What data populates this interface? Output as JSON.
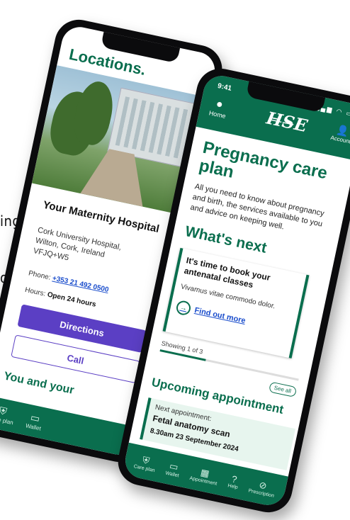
{
  "cut_text": {
    "line1": "ing",
    "line2": "on"
  },
  "back_phone": {
    "title": "Locations.",
    "hospital_name": "Your Maternity Hospital",
    "address": [
      "Cork University Hospital,",
      "Wilton, Cork, Ireland",
      "VFJQ+W5"
    ],
    "phone_label": "Phone:",
    "phone_number": "+353 21 492 0500",
    "hours_label": "Hours:",
    "hours_value": "Open 24 hours",
    "directions": "Directions",
    "call": "Call",
    "section_title": "You and your",
    "nav": [
      {
        "label": "Care plan",
        "icon": "shield-icon"
      },
      {
        "label": "Wallet",
        "icon": "wallet-icon"
      }
    ]
  },
  "front_phone": {
    "status_time": "9:41",
    "home_label": "Home",
    "logo": "HSE",
    "account_label": "Account",
    "title": "Pregnancy care plan",
    "description": "All you need to know about pregnancy and birth, the services available to you and advice on keeping well.",
    "whats_next": "What's next",
    "card": {
      "title": "It's time to book your antenatal classes",
      "text": "Vivamus vitae commodo dolor.",
      "link": "Find out more"
    },
    "showing": "Showing 1 of 3",
    "see_all": "See all",
    "upcoming_title": "Upcoming appointment",
    "appointment": {
      "label": "Next appointment:",
      "name": "Fetal anatomy scan",
      "datetime": "8.30am 23 September 2024"
    },
    "nav": [
      {
        "label": "Care plan",
        "icon": "shield-icon"
      },
      {
        "label": "Wallet",
        "icon": "wallet-icon"
      },
      {
        "label": "Appointment",
        "icon": "calendar-icon"
      },
      {
        "label": "Help",
        "icon": "help-icon"
      },
      {
        "label": "Prescription",
        "icon": "pill-icon"
      }
    ]
  },
  "colors": {
    "brand_green": "#0a6e4e",
    "purple": "#5b3fc4",
    "link_blue": "#1a4dcc"
  }
}
